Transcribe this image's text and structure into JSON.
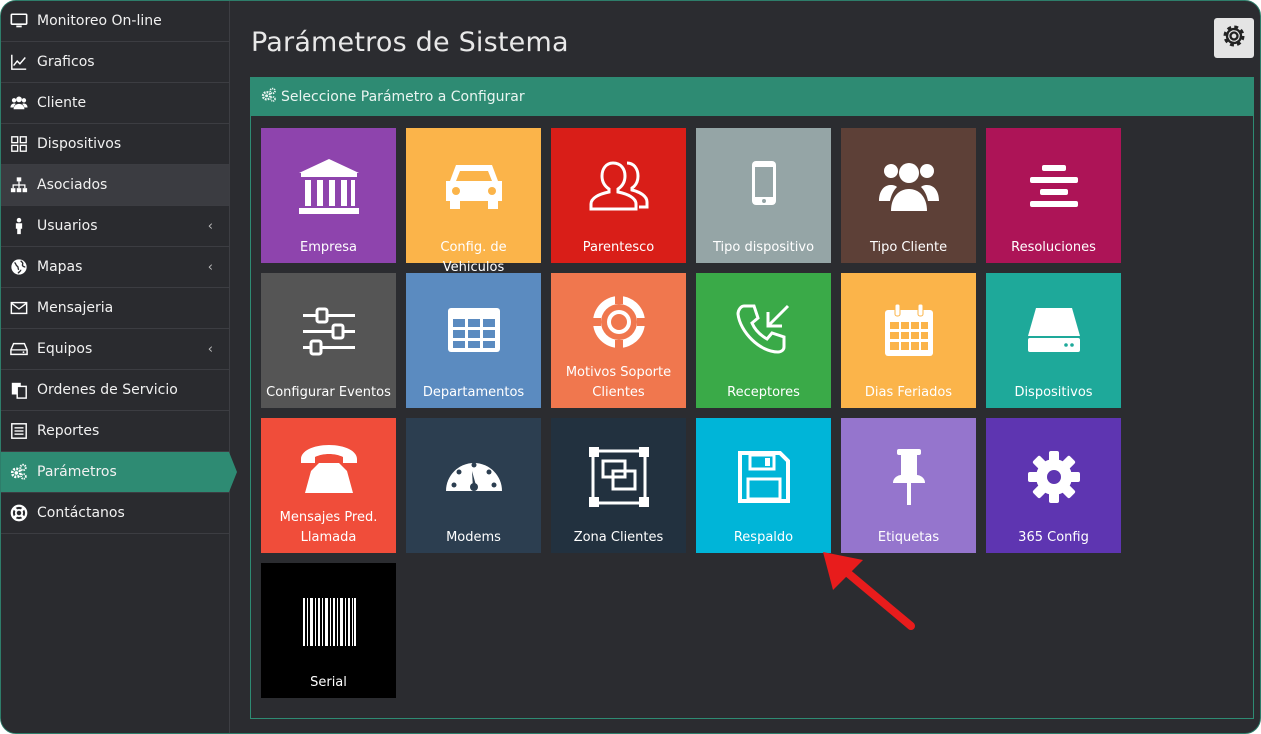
{
  "sidebar": {
    "items": [
      {
        "label": "Monitoreo On-line",
        "icon": "monitor-icon"
      },
      {
        "label": "Graficos",
        "icon": "line-chart-icon"
      },
      {
        "label": "Cliente",
        "icon": "users-icon"
      },
      {
        "label": "Dispositivos",
        "icon": "grid-icon"
      },
      {
        "label": "Asociados",
        "icon": "sitemap-icon"
      },
      {
        "label": "Usuarios",
        "icon": "user-icon",
        "chevron": "‹"
      },
      {
        "label": "Mapas",
        "icon": "globe-icon",
        "chevron": "‹"
      },
      {
        "label": "Mensajeria",
        "icon": "envelope-icon"
      },
      {
        "label": "Equipos",
        "icon": "hdd-icon",
        "chevron": "‹"
      },
      {
        "label": "Ordenes de Servicio",
        "icon": "copy-icon"
      },
      {
        "label": "Reportes",
        "icon": "list-icon"
      },
      {
        "label": "Parámetros",
        "icon": "cogs-icon"
      },
      {
        "label": "Contáctanos",
        "icon": "lifebuoy-icon"
      }
    ],
    "highlighted_index": 4,
    "active_index": 11
  },
  "page": {
    "title": "Parámetros de Sistema",
    "settings_icon": "gear-icon"
  },
  "panel": {
    "heading": "Seleccione Parámetro a Configurar",
    "heading_icon": "cogs-icon"
  },
  "tiles": [
    {
      "label": "Empresa",
      "icon": "bank-icon",
      "color": "#8e44ad"
    },
    {
      "label": "Config. de Vehiculos",
      "icon": "car-icon",
      "color": "#fbb44a"
    },
    {
      "label": "Parentesco",
      "icon": "user-pair-icon",
      "color": "#d91e18"
    },
    {
      "label": "Tipo dispositivo",
      "icon": "mobile-icon",
      "color": "#95a5a6"
    },
    {
      "label": "Tipo Cliente",
      "icon": "users-icon",
      "color": "#5d4037"
    },
    {
      "label": "Resoluciones",
      "icon": "align-center-icon",
      "color": "#ad1457"
    },
    {
      "label": "Configurar Eventos",
      "icon": "sliders-icon",
      "color": "#555555"
    },
    {
      "label": "Departamentos",
      "icon": "table-icon",
      "color": "#5b8bc0"
    },
    {
      "label": "Motivos Soporte Clientes",
      "icon": "lifebuoy-icon",
      "color": "#f0774e"
    },
    {
      "label": "Receptores",
      "icon": "phone-incoming-icon",
      "color": "#3aaa48"
    },
    {
      "label": "Dias Feriados",
      "icon": "calendar-icon",
      "color": "#fbb44a"
    },
    {
      "label": "Dispositivos",
      "icon": "hdd-icon",
      "color": "#1ea99a"
    },
    {
      "label": "Mensajes Pred. Llamada",
      "icon": "phone-icon",
      "color": "#f04d3a"
    },
    {
      "label": "Modems",
      "icon": "dashboard-icon",
      "color": "#2c3e50"
    },
    {
      "label": "Zona Clientes",
      "icon": "object-group-icon",
      "color": "#22313f"
    },
    {
      "label": "Respaldo",
      "icon": "floppy-icon",
      "color": "#00b5d8"
    },
    {
      "label": "Etiquetas",
      "icon": "pushpin-icon",
      "color": "#9575cd"
    },
    {
      "label": "365 Config",
      "icon": "gear-icon",
      "color": "#5e35b1"
    },
    {
      "label": "Serial",
      "icon": "barcode-icon",
      "color": "#000000"
    }
  ],
  "annotation": {
    "icon": "red-arrow-icon",
    "color": "#e81c1c"
  }
}
